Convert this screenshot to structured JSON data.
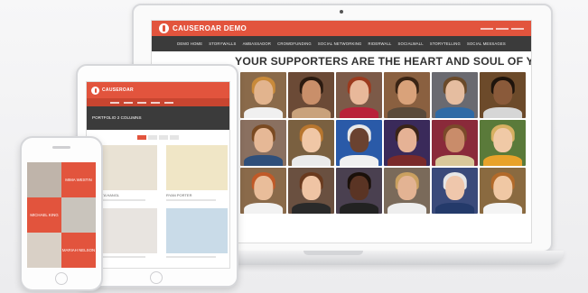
{
  "laptop": {
    "site": {
      "logo_text": "CAUSEROAR DEMO",
      "logo_tagline": "",
      "nav": [
        "DEMO HOME",
        "STORYWALLS",
        "AMBASSADOR",
        "CROWDFUNDING",
        "SOCIAL NETWORKING",
        "RIDERWALL",
        "SOCIALWALL",
        "STORYTELLING",
        "SOCIAL MESSAGES"
      ],
      "headline": "YOUR SUPPORTERS ARE THE HEART AND SOUL OF YOUR ORGANIZATION"
    },
    "photos": [
      {
        "bg": "#8a6a4a",
        "skin": "#e2b48e",
        "hair": "#c98a3a",
        "shirt": "#f0f0f0"
      },
      {
        "bg": "#6b4a36",
        "skin": "#c98f6a",
        "hair": "#2b1a10",
        "shirt": "#c9a27c"
      },
      {
        "bg": "#7c5a48",
        "skin": "#e8b89a",
        "hair": "#9c3a1e",
        "shirt": "#b9213a"
      },
      {
        "bg": "#8a6040",
        "skin": "#d9a27a",
        "hair": "#3a2414",
        "shirt": "#5a4a3a"
      },
      {
        "bg": "#6a6a70",
        "skin": "#e5bda0",
        "hair": "#6a4a2a",
        "shirt": "#2e6aa6"
      },
      {
        "bg": "#6c4a2a",
        "skin": "#8a5a3a",
        "hair": "#1e140c",
        "shirt": "#d6d6d6"
      },
      {
        "bg": "#8a7060",
        "skin": "#e6b896",
        "hair": "#7a4a22",
        "shirt": "#2f4f7a"
      },
      {
        "bg": "#7a6040",
        "skin": "#f0c7a6",
        "hair": "#b8762e",
        "shirt": "#eaeaea"
      },
      {
        "bg": "#2a5aa8",
        "skin": "#6a4230",
        "hair": "#e8e8e8",
        "shirt": "#f0f0f0"
      },
      {
        "bg": "#3a2a5a",
        "skin": "#e5b295",
        "hair": "#3a2418",
        "shirt": "#7a2a2a"
      },
      {
        "bg": "#8a2a3a",
        "skin": "#c98c6a",
        "hair": "#7a4a2a",
        "shirt": "#d9c89a"
      },
      {
        "bg": "#5a7a3a",
        "skin": "#f0c9a6",
        "hair": "#d7b062",
        "shirt": "#e8a22a"
      },
      {
        "bg": "#8a6a4a",
        "skin": "#e9bd9a",
        "hair": "#c05a28",
        "shirt": "#f2f2f2"
      },
      {
        "bg": "#6a5040",
        "skin": "#efc4a4",
        "hair": "#6a3a1e",
        "shirt": "#2a2a2a"
      },
      {
        "bg": "#4a4050",
        "skin": "#5a3424",
        "hair": "#1a100a",
        "shirt": "#222"
      },
      {
        "bg": "#7a6a5a",
        "skin": "#e3b393",
        "hair": "#caa060",
        "shirt": "#eee"
      },
      {
        "bg": "#3a4a7a",
        "skin": "#efc7ac",
        "hair": "#e6e6e6",
        "shirt": "#243a6a"
      },
      {
        "bg": "#8a6a40",
        "skin": "#f0c8a4",
        "hair": "#b26a2a",
        "shirt": "#f4f4f4"
      }
    ]
  },
  "tablet": {
    "logo_text": "CAUSEROAR",
    "band_title": "PORTFOLIO 2 COLUMNS",
    "cards": [
      {
        "name": "ANITA HANGL",
        "bg": "#e9e2d4",
        "skin": "#e6b796",
        "hair": "#c08a4a",
        "shirt": "#ffffff"
      },
      {
        "name": "RYAN PORTER",
        "bg": "#f0e6c6",
        "skin": "#efc5a0",
        "hair": "#c4672a",
        "shirt": "#3a5a8a"
      },
      {
        "name": "",
        "bg": "#e8e4e0",
        "skin": "#e6b8a0",
        "hair": "#e5e5e5",
        "shirt": "#3a3a3a"
      },
      {
        "name": "",
        "bg": "#c9dbe8",
        "skin": "#f2caa8",
        "hair": "#d9a04a",
        "shirt": "#e8eef4"
      }
    ]
  },
  "phone": {
    "tiles": [
      {
        "type": "photo",
        "bg": "#bfb4aa",
        "skin": "#f0c8a8",
        "hair": "#6a4a2a",
        "shirt": "#fff"
      },
      {
        "type": "text",
        "label": "MIMA WESTIN"
      },
      {
        "type": "text",
        "label": "MICHAEL KING"
      },
      {
        "type": "photo",
        "bg": "#c9c4bc",
        "skin": "#5a3424",
        "hair": "#1a100a",
        "shirt": "#223"
      },
      {
        "type": "photo",
        "bg": "#d9d0c6",
        "skin": "#efc6a6",
        "hair": "#4a2a1a",
        "shirt": "#fff"
      },
      {
        "type": "text",
        "label": "MARIAH NELSON"
      }
    ]
  }
}
